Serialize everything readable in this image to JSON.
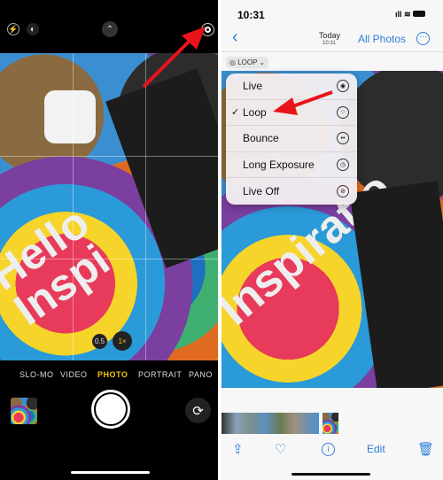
{
  "camera": {
    "top_icons": [
      "flash-off-icon",
      "night-mode-icon",
      "chevron-up-icon",
      "live-photo-icon"
    ],
    "photo_text": "Hello Inspi",
    "zoom_options": [
      "0.5",
      "1×"
    ],
    "modes": [
      "SLO-MO",
      "VIDEO",
      "PHOTO",
      "PORTRAIT",
      "PANO"
    ],
    "active_mode": "PHOTO",
    "accent": "#f5c518"
  },
  "photos": {
    "status_time": "10:31",
    "nav": {
      "title": "Today",
      "subtitle": "10:31",
      "all_photos": "All Photos"
    },
    "live_pill": "LOOP",
    "photo_text": "Inspiratio",
    "menu": [
      {
        "label": "Live",
        "icon": "live-icon",
        "checked": false
      },
      {
        "label": "Loop",
        "icon": "loop-icon",
        "checked": true
      },
      {
        "label": "Bounce",
        "icon": "bounce-icon",
        "checked": false
      },
      {
        "label": "Long Exposure",
        "icon": "long-exposure-icon",
        "checked": false
      },
      {
        "label": "Live Off",
        "icon": "live-off-icon",
        "checked": false
      }
    ],
    "check": "✓",
    "toolbar": {
      "edit": "Edit"
    },
    "accent": "#2f7fd6"
  }
}
